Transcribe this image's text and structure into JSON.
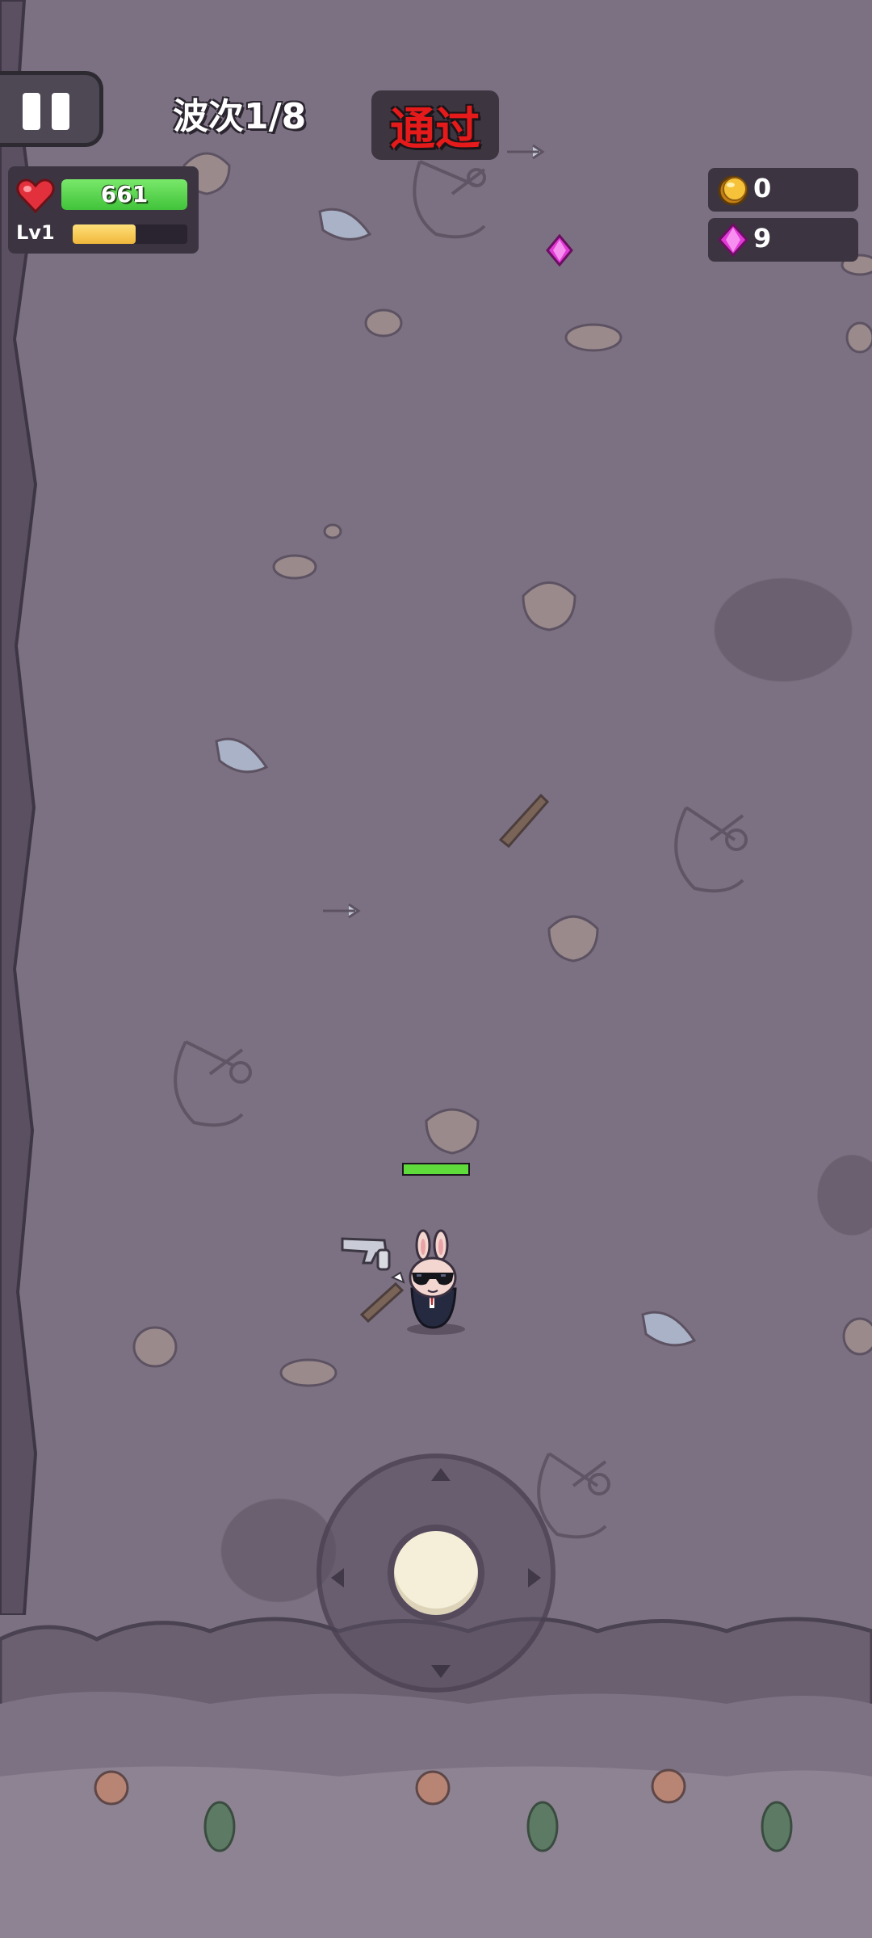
{
  "hud": {
    "wave_label": "波次1/8",
    "pass_button_label": "通过",
    "hp_value": "661",
    "hp_fraction": 1.0,
    "level_label": "Lv1",
    "xp_fraction": 0.55,
    "gold_count": "0",
    "gem_count": "9"
  },
  "player": {
    "health_fraction": 1.0
  },
  "colors": {
    "hp_green": "#41c33a",
    "xp_yellow": "#f0b73a",
    "pass_red": "#e51a1a",
    "gem_pink": "#e23ad6",
    "ground": "#7c7182"
  },
  "icons": [
    "pause-icon",
    "heart-icon",
    "gold-coin-icon",
    "pink-gem-icon",
    "revolver-icon"
  ]
}
